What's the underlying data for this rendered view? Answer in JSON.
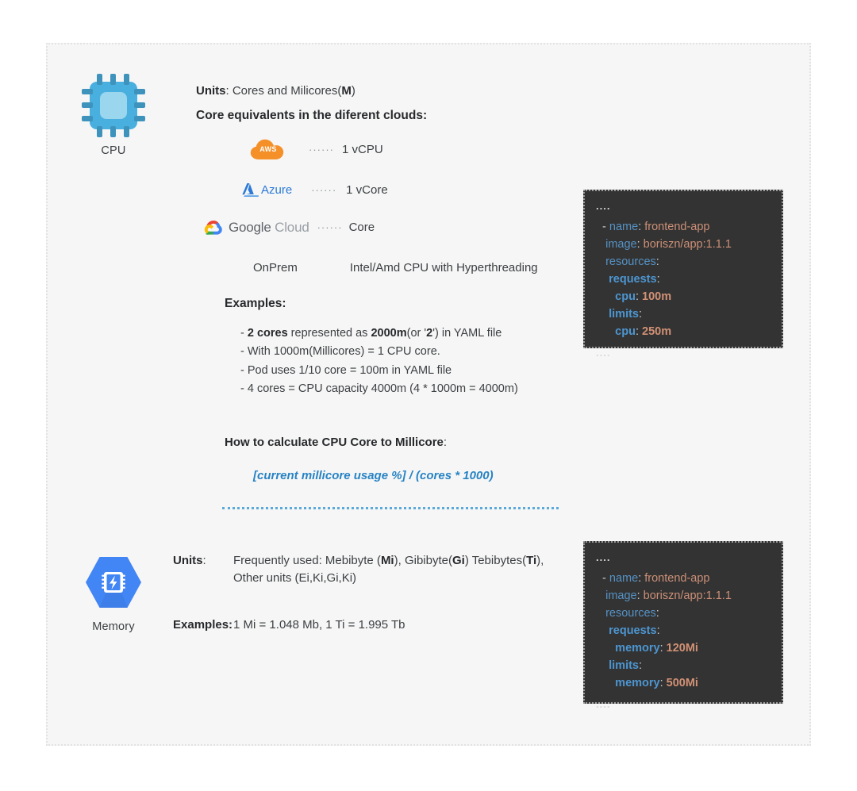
{
  "page": {
    "background": "#ffffff",
    "canvas_background": "#f6f6f6",
    "border_color": "#e2e2e2",
    "accent_blue": "#2783c4",
    "divider_color": "#5aa9db"
  },
  "cpu_section": {
    "icon_name": "cpu-chip-icon",
    "icon_caption": "CPU",
    "icon_color": "#49afdf",
    "units_label": "Units",
    "units_value": ": Cores and Milicores(",
    "units_value_bold": "M",
    "units_value_end": ")",
    "core_equivalents_heading": "Core equivalents in the diferent clouds:",
    "clouds": [
      {
        "provider": "AWS",
        "logo_name": "aws-logo",
        "logo_color": "#f59029",
        "separator": "······",
        "value": "1 vCPU"
      },
      {
        "provider": "Azure",
        "logo_name": "azure-logo",
        "logo_color": "#2c7ad6",
        "separator": "······",
        "value": "1 vCore"
      },
      {
        "provider": "Google Cloud",
        "provider_light": "Cloud",
        "provider_dark": "Google",
        "logo_name": "google-cloud-logo",
        "separator": "······",
        "value": "Core"
      },
      {
        "provider": "OnPrem",
        "logo_name": "onprem-text",
        "separator": "",
        "value": "Intel/Amd CPU with Hyperthreading"
      }
    ],
    "examples_heading": "Examples:",
    "examples": [
      {
        "prefix": "- ",
        "b1": "2 cores",
        "mid1": " represented as ",
        "b2": "2000m",
        "mid2": "(or '",
        "b3": "2",
        "suffix": "') in YAML file"
      }
    ],
    "examples_plain": [
      "- With 1000m(Millicores) =  1 CPU core.",
      "- Pod uses 1/10 core = 100m in YAML file",
      "- 4 cores = CPU capacity 4000m (4 * 1000m = 4000m)"
    ],
    "calc_heading": "How to calculate CPU Core to Millicore",
    "calc_heading_colon": ":",
    "formula": "[current millicore usage %] / (cores * 1000)"
  },
  "memory_section": {
    "icon_name": "memory-hexagon-icon",
    "icon_caption": "Memory",
    "icon_color": "#4285f4",
    "units_label": "Units",
    "units_colon": ":",
    "units_line1_a": "Frequently used: Mebibyte (",
    "units_line1_b1": "Mi",
    "units_line1_b": "), Gibibyte(",
    "units_line1_b2": "Gi",
    "units_line1_c": ") Tebibytes(",
    "units_line1_b3": "Ti",
    "units_line1_d": "),",
    "units_line2": "Other units (Ei,Ki,Gi,Ki)",
    "examples_label": "Examples:",
    "examples_value": "1 Mi = 1.048 Mb, 1 Ti =  1.995 Tb"
  },
  "cpu_code_block": {
    "top_dots": "....",
    "bottom_dots": "....",
    "background": "#333333",
    "lines": [
      {
        "indent": 2,
        "dash": "- ",
        "key": "name",
        "sep": ": ",
        "value": "frontend-app",
        "bold": false
      },
      {
        "indent": 3,
        "dash": "",
        "key": "image",
        "sep": ": ",
        "value": "boriszn/app:1.1.1",
        "bold": false
      },
      {
        "indent": 3,
        "dash": "",
        "key": "resources",
        "sep": ":",
        "value": "",
        "bold": false
      },
      {
        "indent": 4,
        "dash": "",
        "key": "requests",
        "sep": ":",
        "value": "",
        "bold": true
      },
      {
        "indent": 6,
        "dash": "",
        "key": "cpu",
        "sep": ": ",
        "value": "100m",
        "bold": true
      },
      {
        "indent": 4,
        "dash": "",
        "key": "limits",
        "sep": ":",
        "value": "",
        "bold": true
      },
      {
        "indent": 6,
        "dash": "",
        "key": "cpu",
        "sep": ": ",
        "value": "250m",
        "bold": true
      }
    ]
  },
  "memory_code_block": {
    "top_dots": "....",
    "bottom_dots": "....",
    "background": "#333333",
    "lines": [
      {
        "indent": 2,
        "dash": "- ",
        "key": "name",
        "sep": ": ",
        "value": "frontend-app",
        "bold": false
      },
      {
        "indent": 3,
        "dash": "",
        "key": "image",
        "sep": ": ",
        "value": "boriszn/app:1.1.1",
        "bold": false
      },
      {
        "indent": 3,
        "dash": "",
        "key": "resources",
        "sep": ":",
        "value": "",
        "bold": false
      },
      {
        "indent": 4,
        "dash": "",
        "key": "requests",
        "sep": ":",
        "value": "",
        "bold": true
      },
      {
        "indent": 6,
        "dash": "",
        "key": "memory",
        "sep": ": ",
        "value": "120Mi",
        "bold": true
      },
      {
        "indent": 4,
        "dash": "",
        "key": "limits",
        "sep": ":",
        "value": "",
        "bold": true
      },
      {
        "indent": 6,
        "dash": "",
        "key": "memory",
        "sep": ": ",
        "value": "500Mi",
        "bold": true
      }
    ]
  }
}
